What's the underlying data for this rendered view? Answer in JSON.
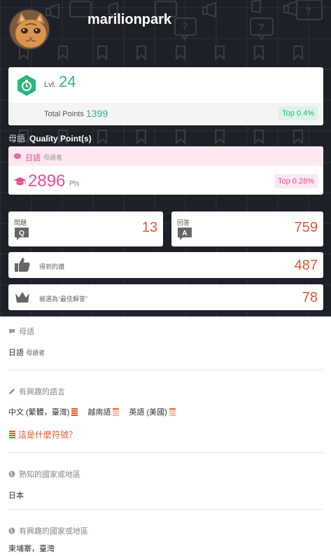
{
  "profile": {
    "username": "marilionpark"
  },
  "level": {
    "label": "Lvl.",
    "value": "24",
    "total_points_label": "Total Points",
    "total_points": "1399",
    "rank": "Top 0.4%"
  },
  "quality": {
    "native_label": "母語",
    "title": "Quality Point(s)",
    "language": "日語",
    "language_level": "母語者",
    "points": "2896",
    "unit": "Pts",
    "rank": "Top 0.28%"
  },
  "stats": {
    "questions_label": "問題",
    "questions": "13",
    "answers_label": "回答",
    "answers": "759",
    "likes_label": "得到的讚",
    "likes": "487",
    "best_label": "被選為“最佳解答”",
    "best": "78"
  },
  "sections": {
    "native": {
      "heading": "母語",
      "lang": "日語",
      "level": "母語者"
    },
    "interested_langs": {
      "heading": "有興趣的語言",
      "items": [
        "中文 (繁體，臺灣)",
        "越南語",
        "英語 (美國)"
      ],
      "what_link": "這是什麼符號？"
    },
    "known_countries": {
      "heading": "熟知的國家或地區",
      "value": "日本"
    },
    "interested_countries": {
      "heading": "有興趣的國家或地區",
      "value": "柬埔寨，臺灣"
    }
  },
  "colors": {
    "green": "#2db67d",
    "pink": "#e54b94",
    "orange": "#e05a2a",
    "dark_bg": "#1d2027"
  },
  "icons": [
    "level-hex-icon",
    "graduation-cap-icon",
    "q-badge-icon",
    "a-badge-icon",
    "thumbs-up-icon",
    "crown-icon",
    "speech-bubble-icon",
    "pencil-icon",
    "globe-icon",
    "proficiency-bars-icon"
  ]
}
